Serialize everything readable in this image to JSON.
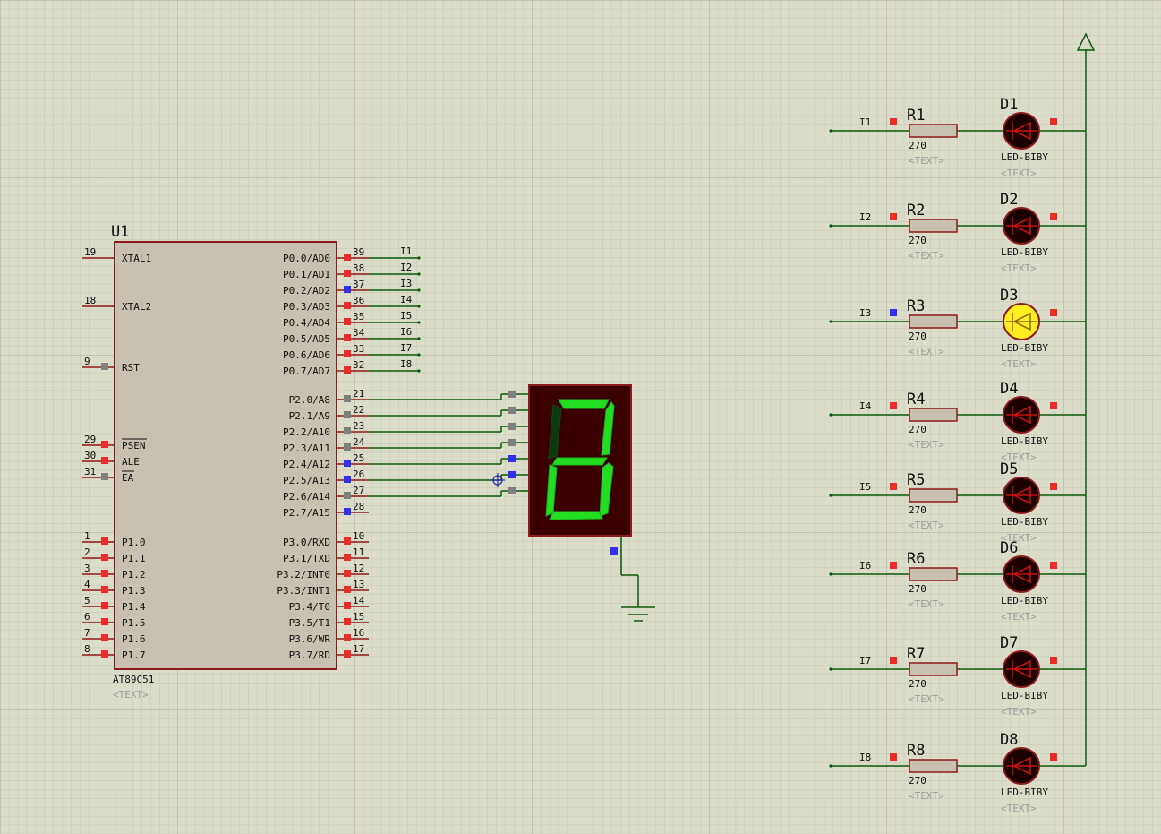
{
  "colors": {
    "background": "#dcdccb",
    "grid_minor": "#c7c7b6",
    "grid_major": "#b8b8a6",
    "chip_fill": "#c8c0b0",
    "chip_border": "#8b1a1a",
    "wire": "#0b5a0b",
    "pin_red": "#ee2a2a",
    "pin_blue": "#3030ee",
    "pin_grey": "#808080",
    "led_on": "#ffee22",
    "led_off": "#1a0000",
    "seg_on": "#22dd22",
    "seg_off": "#0a3a0a",
    "display_bg": "#3a0000"
  },
  "mcu": {
    "ref": "U1",
    "part": "AT89C51",
    "text_placeholder": "<TEXT>",
    "left_pins": [
      {
        "num": "19",
        "name": "XTAL1",
        "state": "none"
      },
      {
        "num": "18",
        "name": "XTAL2",
        "state": "none"
      },
      {
        "num": "9",
        "name": "RST",
        "state": "grey"
      },
      {
        "num": "29",
        "name": "PSEN",
        "state": "red"
      },
      {
        "num": "30",
        "name": "ALE",
        "state": "red"
      },
      {
        "num": "31",
        "name": "EA",
        "state": "grey"
      },
      {
        "num": "1",
        "name": "P1.0",
        "state": "red"
      },
      {
        "num": "2",
        "name": "P1.1",
        "state": "red"
      },
      {
        "num": "3",
        "name": "P1.2",
        "state": "red"
      },
      {
        "num": "4",
        "name": "P1.3",
        "state": "red"
      },
      {
        "num": "5",
        "name": "P1.4",
        "state": "red"
      },
      {
        "num": "6",
        "name": "P1.5",
        "state": "red"
      },
      {
        "num": "7",
        "name": "P1.6",
        "state": "red"
      },
      {
        "num": "8",
        "name": "P1.7",
        "state": "red"
      }
    ],
    "right_pins": [
      {
        "num": "39",
        "name": "P0.0/AD0",
        "state": "red",
        "label": "I1"
      },
      {
        "num": "38",
        "name": "P0.1/AD1",
        "state": "red",
        "label": "I2"
      },
      {
        "num": "37",
        "name": "P0.2/AD2",
        "state": "blue",
        "label": "I3"
      },
      {
        "num": "36",
        "name": "P0.3/AD3",
        "state": "red",
        "label": "I4"
      },
      {
        "num": "35",
        "name": "P0.4/AD4",
        "state": "red",
        "label": "I5"
      },
      {
        "num": "34",
        "name": "P0.5/AD5",
        "state": "red",
        "label": "I6"
      },
      {
        "num": "33",
        "name": "P0.6/AD6",
        "state": "red",
        "label": "I7"
      },
      {
        "num": "32",
        "name": "P0.7/AD7",
        "state": "red",
        "label": "I8"
      },
      {
        "num": "21",
        "name": "P2.0/A8",
        "state": "grey",
        "label": ""
      },
      {
        "num": "22",
        "name": "P2.1/A9",
        "state": "grey",
        "label": ""
      },
      {
        "num": "23",
        "name": "P2.2/A10",
        "state": "grey",
        "label": ""
      },
      {
        "num": "24",
        "name": "P2.3/A11",
        "state": "grey",
        "label": ""
      },
      {
        "num": "25",
        "name": "P2.4/A12",
        "state": "blue",
        "label": ""
      },
      {
        "num": "26",
        "name": "P2.5/A13",
        "state": "blue",
        "label": ""
      },
      {
        "num": "27",
        "name": "P2.6/A14",
        "state": "grey",
        "label": ""
      },
      {
        "num": "28",
        "name": "P2.7/A15",
        "state": "blue",
        "label": ""
      },
      {
        "num": "10",
        "name": "P3.0/RXD",
        "state": "red",
        "label": ""
      },
      {
        "num": "11",
        "name": "P3.1/TXD",
        "state": "red",
        "label": ""
      },
      {
        "num": "12",
        "name": "P3.2/INT0",
        "state": "red",
        "label": ""
      },
      {
        "num": "13",
        "name": "P3.3/INT1",
        "state": "red",
        "label": ""
      },
      {
        "num": "14",
        "name": "P3.4/T0",
        "state": "red",
        "label": ""
      },
      {
        "num": "15",
        "name": "P3.5/T1",
        "state": "red",
        "label": ""
      },
      {
        "num": "16",
        "name": "P3.6/WR",
        "state": "red",
        "label": ""
      },
      {
        "num": "17",
        "name": "P3.7/RD",
        "state": "red",
        "label": ""
      }
    ]
  },
  "seven_segment": {
    "segments_lit": [
      "a",
      "b",
      "c",
      "d",
      "e",
      "g"
    ],
    "segments_dim": [
      "f"
    ],
    "pin_states": [
      "grey",
      "grey",
      "grey",
      "grey",
      "blue",
      "blue",
      "grey"
    ],
    "common_pin_state": "blue"
  },
  "led_rows": [
    {
      "net": "I1",
      "net_pin": "red",
      "res": "R1",
      "res_val": "270",
      "led": "D1",
      "led_part": "LED-BIBY",
      "on": false,
      "out_pin": "red",
      "text": "<TEXT>"
    },
    {
      "net": "I2",
      "net_pin": "red",
      "res": "R2",
      "res_val": "270",
      "led": "D2",
      "led_part": "LED-BIBY",
      "on": false,
      "out_pin": "red",
      "text": "<TEXT>"
    },
    {
      "net": "I3",
      "net_pin": "blue",
      "res": "R3",
      "res_val": "270",
      "led": "D3",
      "led_part": "LED-BIBY",
      "on": true,
      "out_pin": "red",
      "text": "<TEXT>"
    },
    {
      "net": "I4",
      "net_pin": "red",
      "res": "R4",
      "res_val": "270",
      "led": "D4",
      "led_part": "LED-BIBY",
      "on": false,
      "out_pin": "red",
      "text": "<TEXT>"
    },
    {
      "net": "I5",
      "net_pin": "red",
      "res": "R5",
      "res_val": "270",
      "led": "D5",
      "led_part": "LED-BIBY",
      "on": false,
      "out_pin": "red",
      "text": "<TEXT>"
    },
    {
      "net": "I6",
      "net_pin": "red",
      "res": "R6",
      "res_val": "270",
      "led": "D6",
      "led_part": "LED-BIBY",
      "on": false,
      "out_pin": "red",
      "text": "<TEXT>"
    },
    {
      "net": "I7",
      "net_pin": "red",
      "res": "R7",
      "res_val": "270",
      "led": "D7",
      "led_part": "LED-BIBY",
      "on": false,
      "out_pin": "red",
      "text": "<TEXT>"
    },
    {
      "net": "I8",
      "net_pin": "red",
      "res": "R8",
      "res_val": "270",
      "led": "D8",
      "led_part": "LED-BIBY",
      "on": false,
      "out_pin": "red",
      "text": "<TEXT>"
    }
  ]
}
